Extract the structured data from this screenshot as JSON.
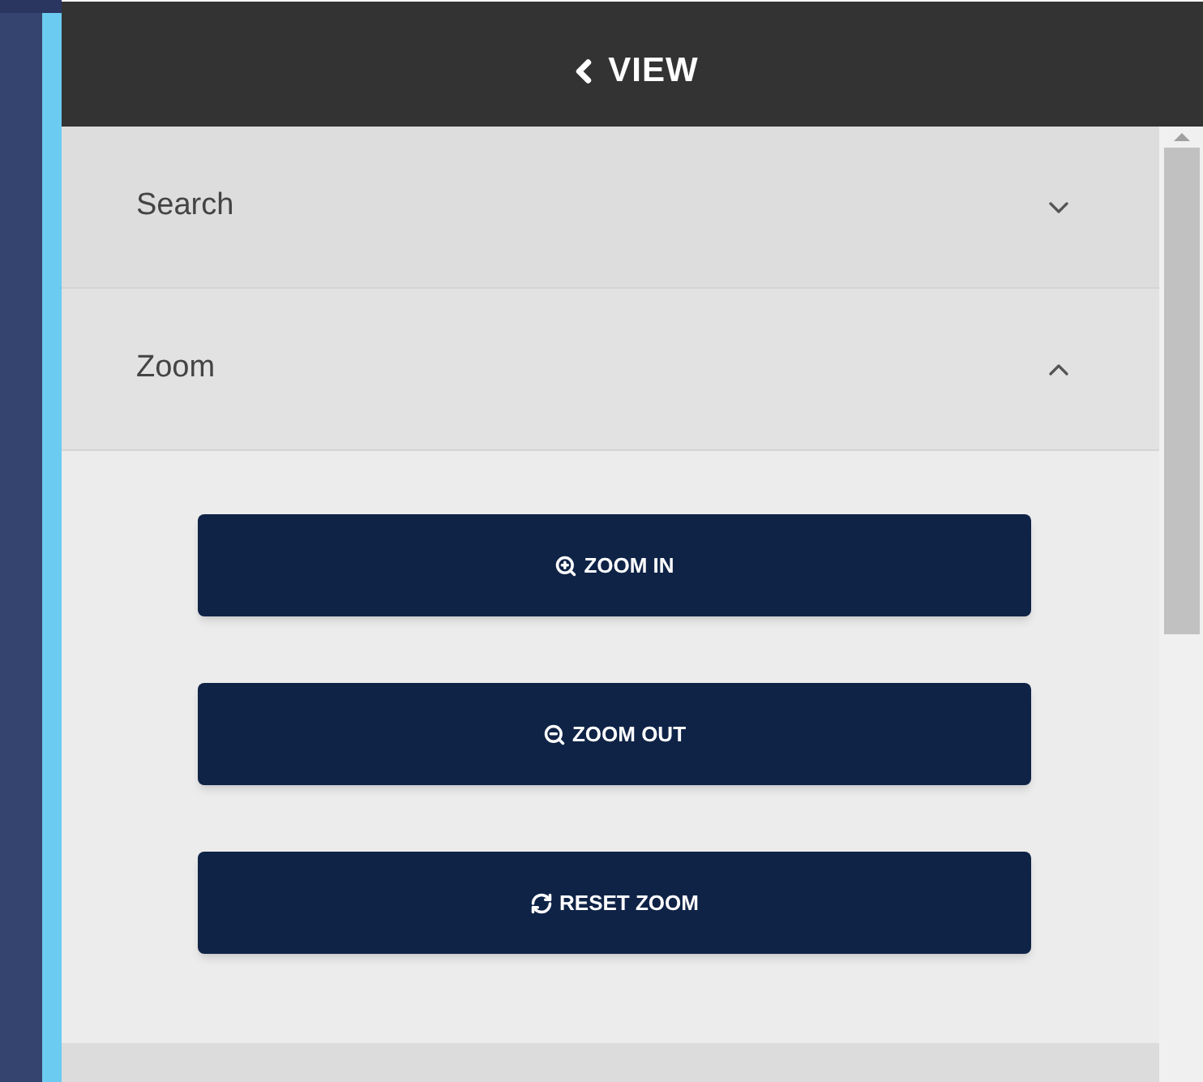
{
  "header": {
    "title": "VIEW"
  },
  "sections": [
    {
      "label": "Search",
      "expanded": false
    },
    {
      "label": "Zoom",
      "expanded": true,
      "buttons": [
        {
          "label": "ZOOM IN",
          "kind": "zoom-in"
        },
        {
          "label": "ZOOM OUT",
          "kind": "zoom-out"
        },
        {
          "label": "RESET ZOOM",
          "kind": "reset"
        }
      ]
    }
  ]
}
